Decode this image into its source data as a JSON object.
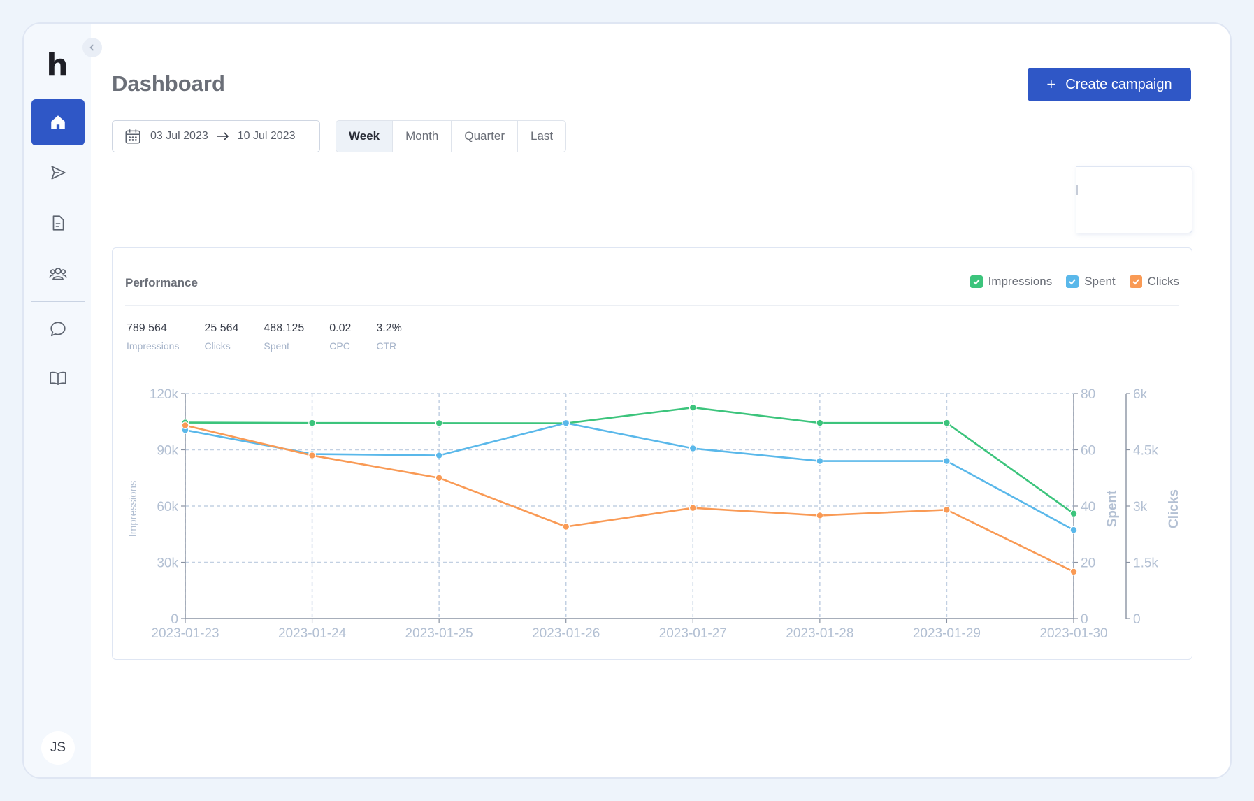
{
  "app": {
    "logo": "h",
    "user_initials": "JS"
  },
  "sidebar": {
    "items": [
      {
        "icon": "home-icon",
        "active": true
      },
      {
        "icon": "send-icon",
        "active": false
      },
      {
        "icon": "document-icon",
        "active": false
      },
      {
        "icon": "users-icon",
        "active": false
      },
      {
        "icon": "chat-icon",
        "active": false
      },
      {
        "icon": "book-icon",
        "active": false
      }
    ]
  },
  "header": {
    "title": "Dashboard",
    "create_label": "Create campaign",
    "create_icon": "plus-icon"
  },
  "filters": {
    "date_from": "03 Jul 2023",
    "date_to": "10 Jul 2023",
    "periods": [
      "Week",
      "Month",
      "Quarter",
      "Last"
    ],
    "active_period": "Week"
  },
  "performance": {
    "title": "Performance",
    "legend": [
      {
        "label": "Impressions",
        "color": "#3cc47c",
        "checked": true
      },
      {
        "label": "Spent",
        "color": "#5ab8ea",
        "checked": true
      },
      {
        "label": "Clicks",
        "color": "#f99a55",
        "checked": true
      }
    ],
    "stats": [
      {
        "value": "789 564",
        "label": "Impressions"
      },
      {
        "value": "25 564",
        "label": "Clicks"
      },
      {
        "value": "488.125",
        "label": "Spent"
      },
      {
        "value": "0.02",
        "label": "CPC"
      },
      {
        "value": "3.2%",
        "label": "CTR"
      }
    ]
  },
  "chart_data": {
    "type": "line",
    "x": [
      "2023-01-23",
      "2023-01-24",
      "2023-01-25",
      "2023-01-26",
      "2023-01-27",
      "2023-01-28",
      "2023-01-29",
      "2023-01-30"
    ],
    "axes": [
      {
        "id": "impressions",
        "label": "Impressions",
        "side": "left",
        "min": 0,
        "max": 120000,
        "ticks": [
          "0",
          "30k",
          "60k",
          "90k",
          "120k"
        ]
      },
      {
        "id": "spent",
        "label": "Spent",
        "side": "right",
        "min": 0,
        "max": 80,
        "ticks": [
          "0",
          "20",
          "40",
          "60",
          "80"
        ]
      },
      {
        "id": "clicks",
        "label": "Clicks",
        "side": "right",
        "min": 0,
        "max": 6000,
        "ticks": [
          "0",
          "1.5k",
          "3k",
          "4.5k",
          "6k"
        ]
      }
    ],
    "series": [
      {
        "name": "Impressions",
        "axis": "impressions",
        "color": "#3cc47c",
        "values": [
          104500,
          104300,
          104200,
          104100,
          112500,
          104300,
          104300,
          56000
        ]
      },
      {
        "name": "Spent",
        "axis": "spent",
        "color": "#5ab8ea",
        "values": [
          67,
          58.5,
          58,
          69.5,
          60.5,
          56,
          56,
          31.5
        ]
      },
      {
        "name": "Clicks",
        "axis": "clicks",
        "color": "#f99a55",
        "values": [
          5150,
          4350,
          3750,
          2450,
          2950,
          2750,
          2900,
          1250
        ]
      }
    ],
    "grid": true,
    "legend_position": "top-right"
  }
}
